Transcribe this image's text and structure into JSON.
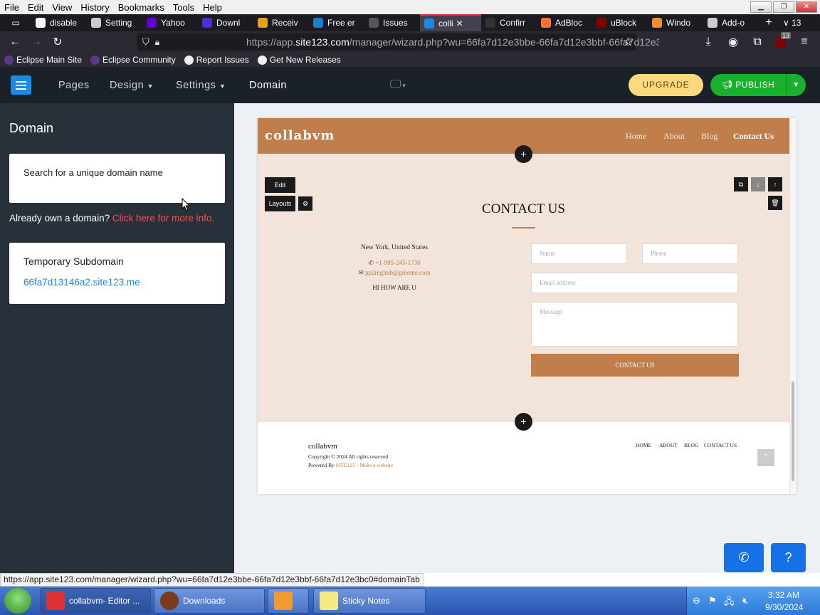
{
  "browser": {
    "menu": [
      "File",
      "Edit",
      "View",
      "History",
      "Bookmarks",
      "Tools",
      "Help"
    ],
    "tabs": [
      {
        "label": "disable",
        "icon": "google-icon",
        "color": "#ffffff"
      },
      {
        "label": "Setting",
        "icon": "gear-icon",
        "color": "#cccccc"
      },
      {
        "label": "Yahoo",
        "icon": "yahoo-icon",
        "color": "#6001d2"
      },
      {
        "label": "Downl",
        "icon": "net-icon",
        "color": "#512bd4"
      },
      {
        "label": "Receiv",
        "icon": "mail-icon",
        "color": "#e6a020"
      },
      {
        "label": "Free er",
        "icon": "m-icon",
        "color": "#1c7ec7"
      },
      {
        "label": "Issues",
        "icon": "github-icon",
        "color": "#555555"
      },
      {
        "label": "colli",
        "icon": "site123-icon",
        "color": "#1e88e5",
        "active": true
      },
      {
        "label": "Confirr",
        "icon": "1-icon",
        "color": "#333333"
      },
      {
        "label": "AdBloc",
        "icon": "firefox-icon",
        "color": "#ff7139"
      },
      {
        "label": "uBlock",
        "icon": "ublock-icon",
        "color": "#800000"
      },
      {
        "label": "Windo",
        "icon": "diamond-icon",
        "color": "#e8912d"
      },
      {
        "label": "Add-o",
        "icon": "puzzle-icon",
        "color": "#cccccc"
      }
    ],
    "tab_count": "13",
    "url_prefix": "https://app.",
    "url_host": "site123.com",
    "url_path": "/manager/wizard.php?wu=66fa7d12e3bbe-66fa7d12e3bbf-66fa7d12e3",
    "badge_count": "13",
    "bookmarks": [
      "Eclipse Main Site",
      "Eclipse Community",
      "Report Issues",
      "Get New Releases"
    ],
    "status_url": "https://app.site123.com/manager/wizard.php?wu=66fa7d12e3bbe-66fa7d12e3bbf-66fa7d12e3bc0#domainTab"
  },
  "editor": {
    "nav": [
      "Pages",
      "Design",
      "Settings",
      "Domain"
    ],
    "upgrade": "UPGRADE",
    "publish": "PUBLISH"
  },
  "sidebar": {
    "title": "Domain",
    "search_placeholder": "Search for a unique domain name",
    "already_own": "Already own a domain?",
    "click_here": "Click here for more info.",
    "temp_title": "Temporary Subdomain",
    "temp_link": "66fa7d13146a2.site123.me"
  },
  "site": {
    "logo": "collabvm",
    "nav": [
      "Home",
      "About",
      "Blog",
      "Contact Us"
    ],
    "edit": "Edit",
    "layouts": "Layouts",
    "heading": "CONTACT US",
    "address": "New York, United States",
    "phone": "+1-985-245-1730",
    "email": "pp2reglmb@gmeme.com",
    "message": "HI HOW ARE U",
    "placeholders": {
      "name": "Name",
      "phone": "Phone",
      "email": "Email address",
      "message": "Message"
    },
    "submit": "CONTACT US",
    "footer_logo": "collabvm",
    "copyright": "Copyright © 2024 All rights reserved",
    "powered_by": "Powered By",
    "powered_link": "SITE123",
    "make_site": "Make a website",
    "footer_nav": [
      "HOME",
      "ABOUT",
      "BLOG",
      "CONTACT US"
    ]
  },
  "taskbar": {
    "items": [
      "collabvm- Editor ...",
      "Downloads",
      "",
      "Sticky Notes"
    ],
    "time": "3:32 AM",
    "date": "9/30/2024"
  }
}
